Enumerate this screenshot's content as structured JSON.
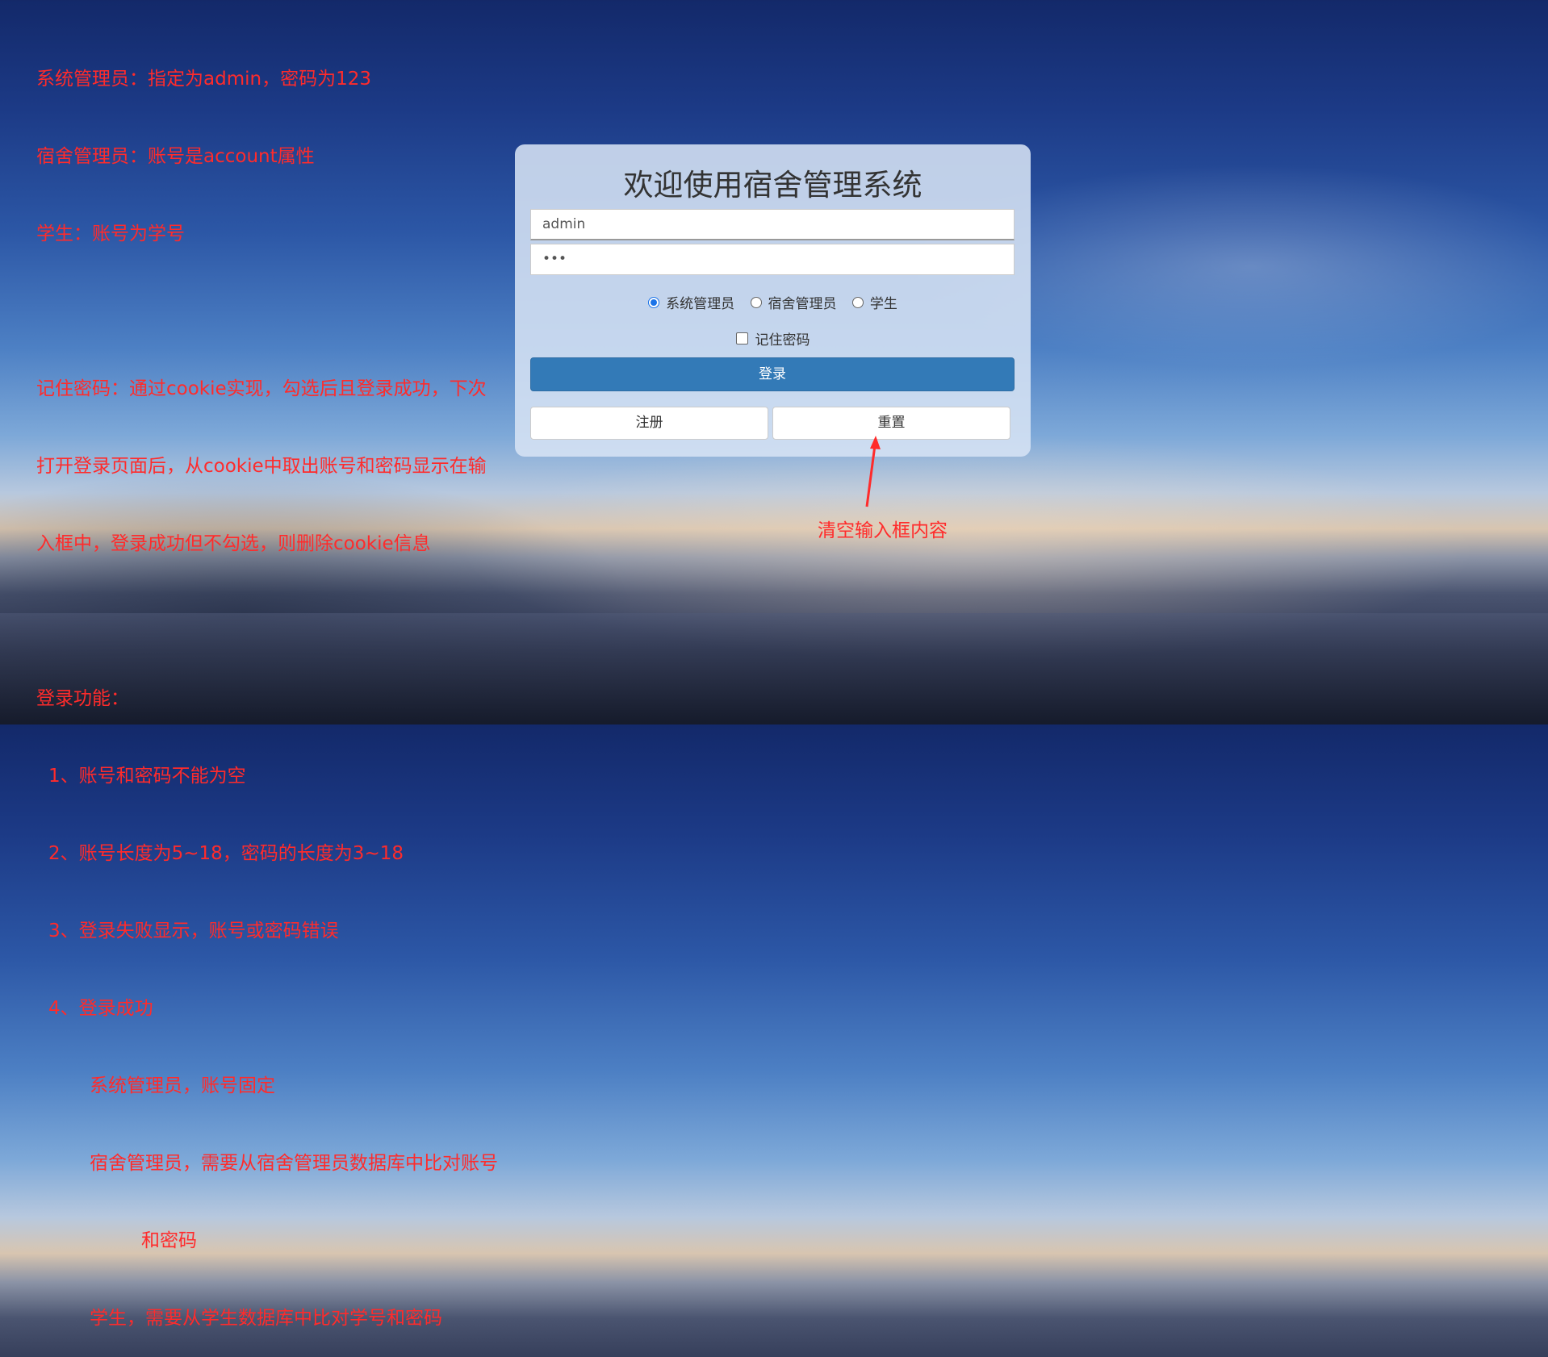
{
  "notes": {
    "lines": [
      "系统管理员：指定为admin，密码为123",
      "宿舍管理员：账号是account属性",
      "学生：账号为学号",
      "",
      "记住密码：通过cookie实现，勾选后且登录成功，下次",
      "打开登录页面后，从cookie中取出账号和密码显示在输",
      "入框中，登录成功但不勾选，则删除cookie信息",
      "",
      "登录功能：",
      "1、账号和密码不能为空",
      "2、账号长度为5~18，密码的长度为3~18",
      "3、登录失败显示，账号或密码错误",
      "4、登录成功",
      "系统管理员，账号固定",
      "宿舍管理员，需要从宿舍管理员数据库中比对账号",
      "和密码",
      "学生，需要从学生数据库中比对学号和密码"
    ]
  },
  "login": {
    "title": "欢迎使用宿舍管理系统",
    "username_value": "admin",
    "password_value": "•••",
    "roles": [
      {
        "label": "系统管理员",
        "checked": true
      },
      {
        "label": "宿舍管理员",
        "checked": false
      },
      {
        "label": "学生",
        "checked": false
      }
    ],
    "remember_label": "记住密码",
    "remember_checked": false,
    "login_button": "登录",
    "register_button": "注册",
    "reset_button": "重置"
  },
  "callout": {
    "text": "清空输入框内容",
    "color": "#ff2b2b"
  },
  "colors": {
    "primary": "#337ab7",
    "annotation": "#ff2b2b"
  }
}
